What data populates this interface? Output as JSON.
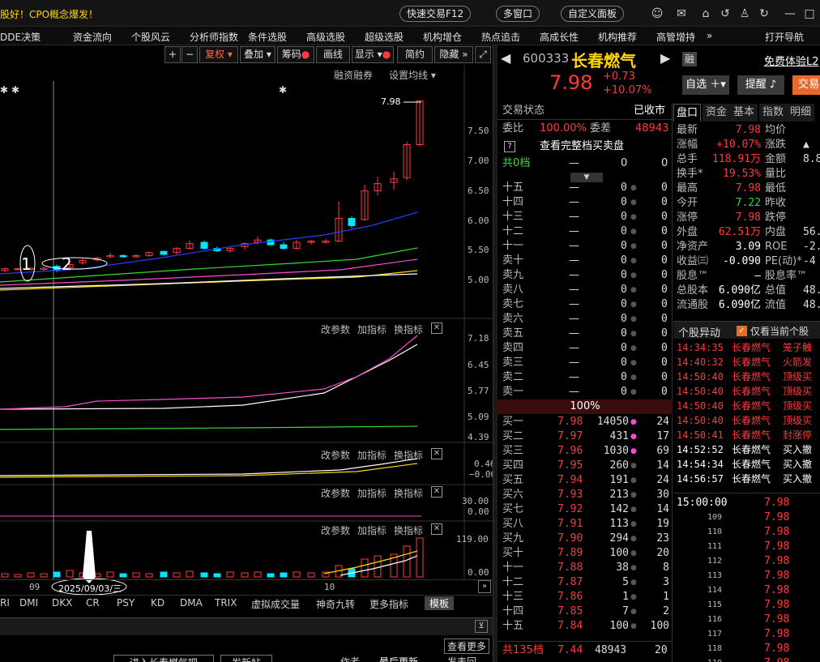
{
  "topbar": {
    "ticker": "股好！CPO概念爆发！",
    "quick_trade": "快速交易F12",
    "multi_window": "多窗口",
    "custom_panel": "自定义面板"
  },
  "menu": [
    "DDE决策",
    "资金流向",
    "个股风云",
    "分析师指数",
    "条件选股",
    "高级选股",
    "超级选股",
    "机构增仓",
    "热点追击",
    "高成长性",
    "机构推荐",
    "高管增持",
    "»",
    "打开导航"
  ],
  "toolbar": {
    "plus": "+",
    "minus": "−",
    "fuquan": "复权",
    "diejia": "叠加",
    "chouma": "筹码",
    "huaxian": "画线",
    "xianshi": "显示",
    "jianyue": "简约",
    "yincang": "隐藏"
  },
  "chart_header": {
    "rzrq": "融资融券",
    "setup_ma": "设置均线"
  },
  "main_axis": [
    "7.50",
    "7.00",
    "6.50",
    "6.00",
    "5.50",
    "5.00"
  ],
  "price_tag": "7.98",
  "annot": {
    "one": "1",
    "two": "2",
    "date": "2025/09/03/三"
  },
  "x_labels": [
    "09",
    "10"
  ],
  "sub1": {
    "axis": [
      "7.18",
      "6.45",
      "5.77",
      "5.09",
      "4.39"
    ]
  },
  "sub2": {
    "axis": [
      "0.46",
      "−0.06"
    ]
  },
  "sub3": {
    "axis": [
      "30.00",
      "0.00"
    ]
  },
  "sub4": {
    "axis": [
      "119.00",
      "0.00"
    ]
  },
  "panel_btns": {
    "params": "改参数",
    "add": "加指标",
    "swap": "换指标"
  },
  "bottom_tabs": [
    "RI",
    "DMI",
    "DKX",
    "CR",
    "PSY",
    "KD",
    "DMA",
    "TRIX",
    "虚拟成交量",
    "神奇九转",
    "更多指标",
    "模板"
  ],
  "bottom_misc": {
    "more": "查看更多",
    "enter": "进入长春燃气吧",
    "post": "发新帖",
    "author": "作者",
    "latest": "最后更新",
    "reply": "发表回"
  },
  "stock": {
    "code": "600333",
    "name": "长春燃气",
    "tag": "融",
    "free": "免费体验L2",
    "price": "7.98",
    "change": "+0.73",
    "pct": "+10.07%",
    "btn_add": "自选",
    "btn_alert": "提醒",
    "btn_trade": "交易"
  },
  "book": {
    "status_l": "交易状态",
    "status_r": "已收市",
    "weibi_l": "委比",
    "weibi_v": "100.00%",
    "weicha_l": "委差",
    "weicha_v": "48943",
    "full": "查看完整档买卖盘",
    "total_ask": "共0档",
    "pct": "100%",
    "total_bid": "共135档",
    "total_bid_price": "7.44",
    "total_bid_vol": "48943",
    "total_bid_n": "20",
    "asks": [
      "十五",
      "十四",
      "十三",
      "十二",
      "十一",
      "卖十",
      "卖九",
      "卖八",
      "卖七",
      "卖六",
      "卖五",
      "卖四",
      "卖三",
      "卖二",
      "卖一"
    ],
    "bids": [
      [
        "买一",
        "7.98",
        "14050",
        "24"
      ],
      [
        "买二",
        "7.97",
        "431",
        "17"
      ],
      [
        "买三",
        "7.96",
        "1030",
        "69"
      ],
      [
        "买四",
        "7.95",
        "260",
        "14"
      ],
      [
        "买五",
        "7.94",
        "191",
        "24"
      ],
      [
        "买六",
        "7.93",
        "213",
        "30"
      ],
      [
        "买七",
        "7.92",
        "142",
        "14"
      ],
      [
        "买八",
        "7.91",
        "113",
        "19"
      ],
      [
        "买九",
        "7.90",
        "294",
        "23"
      ],
      [
        "买十",
        "7.89",
        "100",
        "20"
      ],
      [
        "十一",
        "7.88",
        "38",
        "8"
      ],
      [
        "十二",
        "7.87",
        "5",
        "3"
      ],
      [
        "十三",
        "7.86",
        "1",
        "1"
      ],
      [
        "十四",
        "7.85",
        "7",
        "2"
      ],
      [
        "十五",
        "7.84",
        "100",
        "100"
      ]
    ]
  },
  "quote_tabs": [
    "盘口",
    "资金",
    "基本",
    "指数",
    "明细"
  ],
  "quote": [
    [
      "最新",
      "7.98",
      "均价",
      ""
    ],
    [
      "涨幅",
      "+10.07%",
      "涨跌",
      "▲"
    ],
    [
      "总手",
      "118.91万",
      "金额",
      "8.8"
    ],
    [
      "换手*",
      "19.53%",
      "量比",
      ""
    ],
    [
      "最高",
      "7.98",
      "最低",
      ""
    ],
    [
      "今开",
      "7.22",
      "昨收",
      ""
    ],
    [
      "涨停",
      "7.98",
      "跌停",
      ""
    ],
    [
      "外盘",
      "62.51万",
      "内盘",
      "56.4"
    ],
    [
      "净资产",
      "3.09",
      "ROE",
      "-2."
    ],
    [
      "收益㈢",
      "-0.090",
      "PE(动)*",
      "-4"
    ],
    [
      "股息™",
      "—",
      "股息率™",
      ""
    ],
    [
      "总股本",
      "6.090亿",
      "总值",
      "48.0"
    ],
    [
      "流通股",
      "6.090亿",
      "流值",
      "48.0"
    ]
  ],
  "alerts": {
    "title": "个股异动",
    "only": "仅看当前个股",
    "rows": [
      [
        "14:34:35",
        "长春燃气",
        "笼子触"
      ],
      [
        "14:40:32",
        "长春燃气",
        "火箭发"
      ],
      [
        "14:50:40",
        "长春燃气",
        "顶级买"
      ],
      [
        "14:50:40",
        "长春燃气",
        "顶级买"
      ],
      [
        "14:50:40",
        "长春燃气",
        "顶级买"
      ],
      [
        "14:50:40",
        "长春燃气",
        "顶级买"
      ],
      [
        "14:50:41",
        "长春燃气",
        "封涨停"
      ],
      [
        "14:52:52",
        "长春燃气",
        "买入撤"
      ],
      [
        "14:54:34",
        "长春燃气",
        "买入撤"
      ],
      [
        "14:56:57",
        "长春燃气",
        "买入撤"
      ]
    ]
  },
  "ticks": [
    [
      "15:00:00",
      "7.98"
    ],
    [
      "109",
      "7.98"
    ],
    [
      "110",
      "7.98"
    ],
    [
      "111",
      "7.98"
    ],
    [
      "112",
      "7.98"
    ],
    [
      "113",
      "7.98"
    ],
    [
      "114",
      "7.98"
    ],
    [
      "115",
      "7.98"
    ],
    [
      "116",
      "7.98"
    ],
    [
      "117",
      "7.98"
    ],
    [
      "118",
      "7.98"
    ],
    [
      "119",
      "7.98"
    ]
  ],
  "colors": {
    "up": "#ff3b3b",
    "down": "#36d936",
    "bg": "#000000",
    "accent": "#e66a2a"
  }
}
